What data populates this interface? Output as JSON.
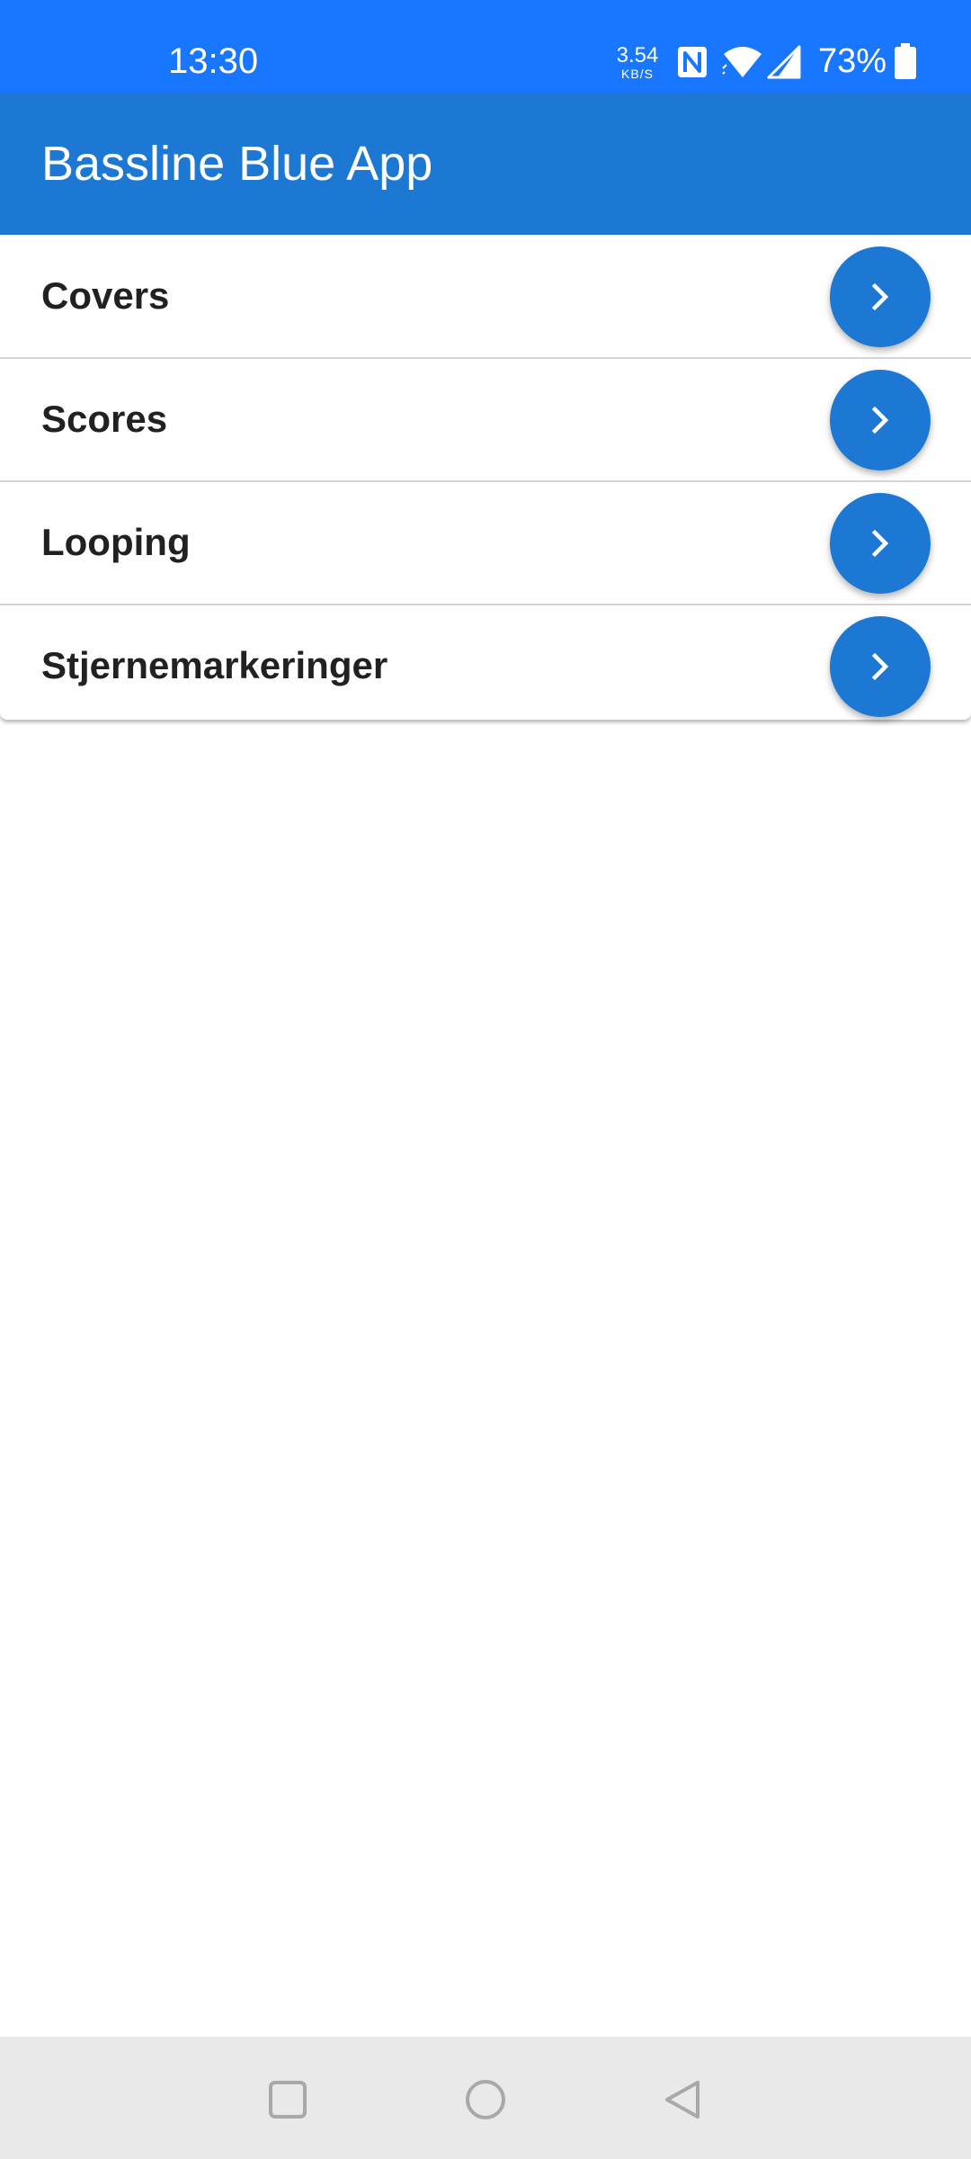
{
  "status_bar": {
    "time": "13:30",
    "net_speed_value": "3.54",
    "net_speed_unit": "KB/S",
    "battery_text": "73%",
    "icons": [
      "nfc-icon",
      "wifi-icon",
      "cell-signal-icon",
      "battery-icon"
    ],
    "background_color": "#1976ff"
  },
  "app_bar": {
    "title": "Bassline Blue App",
    "background_color": "#1c78d2"
  },
  "menu": {
    "items": [
      {
        "label": "Covers",
        "action_icon": "chevron-right-icon"
      },
      {
        "label": "Scores",
        "action_icon": "chevron-right-icon"
      },
      {
        "label": "Looping",
        "action_icon": "chevron-right-icon"
      },
      {
        "label": "Stjernemarkeringer",
        "action_icon": "chevron-right-icon"
      }
    ],
    "button_color": "#1c78d2"
  },
  "nav_bar": {
    "buttons": [
      "recents-icon",
      "home-icon",
      "back-icon"
    ]
  }
}
